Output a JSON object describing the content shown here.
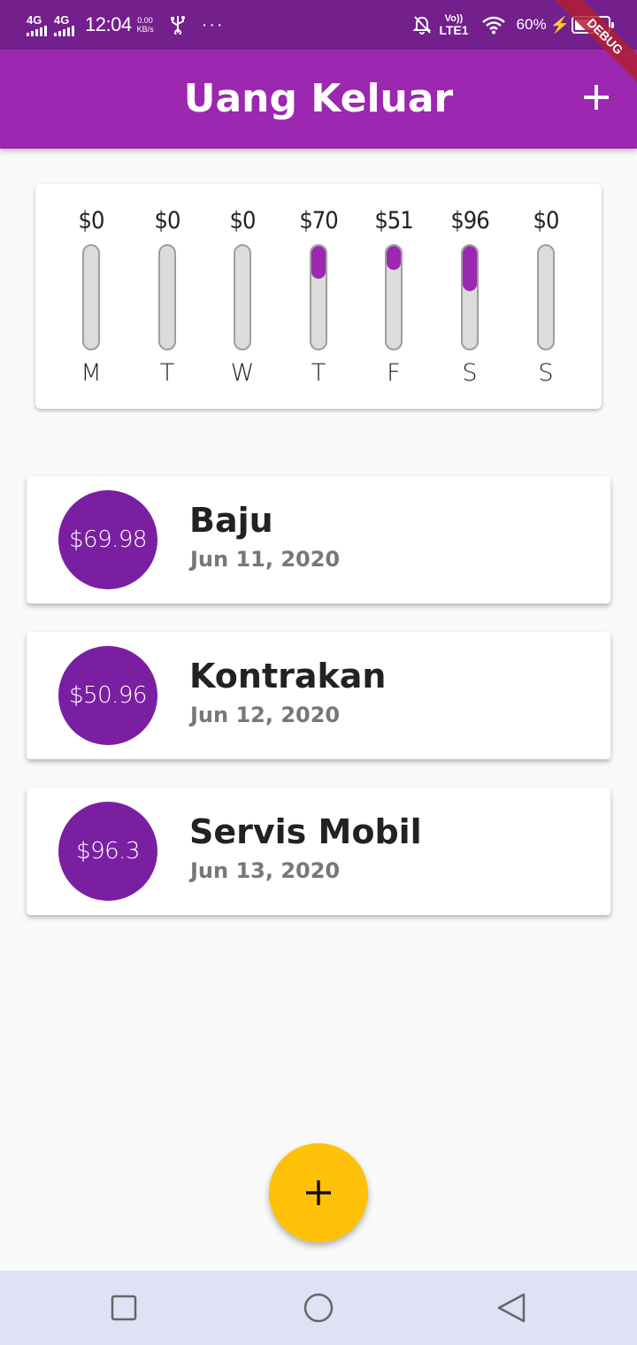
{
  "status_bar": {
    "signal_1": "4G",
    "signal_2": "4G",
    "time": "12:04",
    "speed_value": "0.00",
    "speed_unit": "KB/s",
    "more": "···",
    "volte_top": "Vo))",
    "volte_bottom": "LTE1",
    "battery_percent": "60%",
    "battery_level": 0.6
  },
  "debug_banner": "DEBUG",
  "app_bar": {
    "title": "Uang Keluar",
    "add_icon": "plus-icon"
  },
  "chart_data": {
    "type": "bar",
    "categories": [
      "M",
      "T",
      "W",
      "T",
      "F",
      "S",
      "S"
    ],
    "labels": [
      "$0",
      "$0",
      "$0",
      "$70",
      "$51",
      "$96",
      "$0"
    ],
    "values": [
      0,
      0,
      0,
      69.98,
      50.96,
      96.3,
      0
    ],
    "fill_fractions": [
      0,
      0,
      0,
      0.32,
      0.23,
      0.44,
      0
    ],
    "colors": {
      "fill": "#9c27b0",
      "track": "#dcdcdc",
      "track_border": "#9e9e9e"
    }
  },
  "transactions": [
    {
      "amount": "$69.98",
      "title": "Baju",
      "date": "Jun 11, 2020"
    },
    {
      "amount": "$50.96",
      "title": "Kontrakan",
      "date": "Jun 12, 2020"
    },
    {
      "amount": "$96.3",
      "title": "Servis Mobil",
      "date": "Jun 13, 2020"
    }
  ],
  "fab": {
    "icon": "plus-icon",
    "color": "#ffc107"
  },
  "nav_bar": {
    "icons": [
      "square-icon",
      "circle-icon",
      "triangle-back-icon"
    ]
  },
  "colors": {
    "primary": "#9c27b0",
    "primary_dark": "#731f8c",
    "avatar": "#7b1fa2",
    "accent": "#ffc107"
  }
}
